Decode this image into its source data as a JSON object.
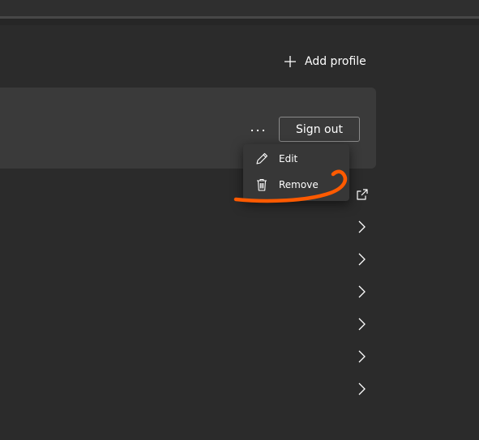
{
  "header": {
    "add_profile_label": "Add profile"
  },
  "profile_card": {
    "more_label": "···",
    "sign_out_label": "Sign out"
  },
  "context_menu": {
    "items": [
      {
        "label": "Edit",
        "icon": "pencil-icon"
      },
      {
        "label": "Remove",
        "icon": "trash-icon"
      }
    ]
  },
  "list": {
    "row_icons": [
      "external-link-icon",
      "chevron-right-icon",
      "chevron-right-icon",
      "chevron-right-icon",
      "chevron-right-icon",
      "chevron-right-icon",
      "chevron-right-icon"
    ]
  },
  "colors": {
    "background": "#2b2b2b",
    "card": "#3a3a3a",
    "menu": "#373737",
    "annotation": "#ff5a00",
    "text": "#ffffff"
  }
}
